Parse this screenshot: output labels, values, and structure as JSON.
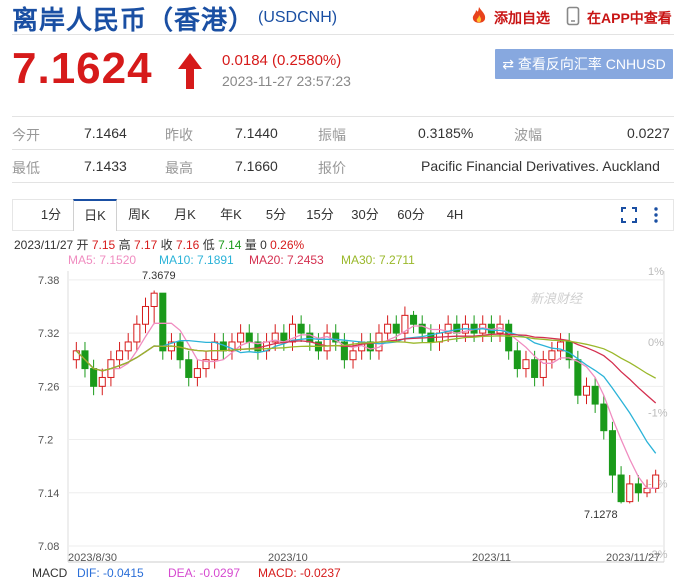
{
  "header": {
    "title": "离岸人民币（香港）",
    "code": "(USDCNH)",
    "add_watch": "添加自选",
    "app_view": "在APP中查看"
  },
  "quote": {
    "price": "7.1624",
    "change": "0.0184 (0.2580%)",
    "time": "2023-11-27 23:57:23",
    "reverse_button": "查看反向汇率 CNHUSD"
  },
  "stats": {
    "open_label": "今开",
    "open": "7.1464",
    "prev_label": "昨收",
    "prev": "7.1440",
    "amp_label": "振幅",
    "amp": "0.3185%",
    "wave_label": "波幅",
    "wave": "0.0227",
    "low_label": "最低",
    "low": "7.1433",
    "high_label": "最高",
    "high": "7.1660",
    "quote_label": "报价",
    "quote_src": "Pacific Financial Derivatives. Auckland"
  },
  "tabs": [
    "1分",
    "日K",
    "周K",
    "月K",
    "年K",
    "5分",
    "15分",
    "30分",
    "60分",
    "4H"
  ],
  "active_tab": "日K",
  "kline_info": {
    "date": "2023/11/27",
    "open_l": "开",
    "open": "7.15",
    "high_l": "高",
    "high": "7.17",
    "close_l": "收",
    "close": "7.16",
    "low_l": "低",
    "low": "7.14",
    "vol_l": "量",
    "vol": "0",
    "pct": "0.26%"
  },
  "ma": {
    "ma5": "MA5: 7.1520",
    "ma10": "MA10: 7.1891",
    "ma20": "MA20: 7.2453",
    "ma30": "MA30: 7.2711"
  },
  "macd": {
    "label": "MACD",
    "dif": "DIF: -0.0415",
    "dea": "DEA: -0.0297",
    "macd": "MACD: -0.0237"
  },
  "colors": {
    "up": "#d61a1a",
    "down": "#1a9a1a",
    "ma5": "#f08cc0",
    "ma10": "#2bb3d8",
    "ma20": "#d42f4f",
    "ma30": "#9ab82a"
  },
  "chart_data": {
    "type": "candlestick",
    "y_ticks": [
      "7.38",
      "7.32",
      "7.26",
      "7.2",
      "7.14",
      "7.08"
    ],
    "pct_ticks": [
      "1%",
      "0%",
      "-1%",
      "-2%",
      "-3%"
    ],
    "x_ticks": [
      "2023/8/30",
      "2023/10",
      "2023/11",
      "2023/11/27"
    ],
    "max_label": "7.3679",
    "min_label": "7.1278",
    "watermark": "新浪财经",
    "ylim": [
      7.08,
      7.39
    ],
    "candles": [
      [
        7.29,
        7.3,
        7.28,
        7.31
      ],
      [
        7.3,
        7.28,
        7.27,
        7.31
      ],
      [
        7.28,
        7.26,
        7.25,
        7.29
      ],
      [
        7.26,
        7.27,
        7.25,
        7.28
      ],
      [
        7.27,
        7.29,
        7.26,
        7.3
      ],
      [
        7.29,
        7.3,
        7.28,
        7.31
      ],
      [
        7.3,
        7.31,
        7.29,
        7.32
      ],
      [
        7.31,
        7.33,
        7.3,
        7.34
      ],
      [
        7.33,
        7.35,
        7.32,
        7.36
      ],
      [
        7.35,
        7.365,
        7.33,
        7.368
      ],
      [
        7.365,
        7.3,
        7.29,
        7.365
      ],
      [
        7.3,
        7.31,
        7.29,
        7.32
      ],
      [
        7.31,
        7.29,
        7.28,
        7.32
      ],
      [
        7.29,
        7.27,
        7.26,
        7.3
      ],
      [
        7.27,
        7.28,
        7.26,
        7.29
      ],
      [
        7.28,
        7.29,
        7.27,
        7.3
      ],
      [
        7.29,
        7.31,
        7.28,
        7.32
      ],
      [
        7.31,
        7.3,
        7.29,
        7.32
      ],
      [
        7.3,
        7.31,
        7.29,
        7.32
      ],
      [
        7.31,
        7.32,
        7.3,
        7.33
      ],
      [
        7.32,
        7.31,
        7.3,
        7.33
      ],
      [
        7.31,
        7.3,
        7.29,
        7.32
      ],
      [
        7.3,
        7.31,
        7.29,
        7.32
      ],
      [
        7.31,
        7.32,
        7.3,
        7.33
      ],
      [
        7.32,
        7.31,
        7.3,
        7.33
      ],
      [
        7.31,
        7.33,
        7.3,
        7.34
      ],
      [
        7.33,
        7.32,
        7.31,
        7.34
      ],
      [
        7.32,
        7.31,
        7.3,
        7.33
      ],
      [
        7.31,
        7.3,
        7.29,
        7.32
      ],
      [
        7.3,
        7.32,
        7.29,
        7.33
      ],
      [
        7.32,
        7.31,
        7.3,
        7.33
      ],
      [
        7.31,
        7.29,
        7.28,
        7.32
      ],
      [
        7.29,
        7.3,
        7.28,
        7.31
      ],
      [
        7.3,
        7.31,
        7.29,
        7.32
      ],
      [
        7.31,
        7.3,
        7.29,
        7.32
      ],
      [
        7.3,
        7.32,
        7.29,
        7.33
      ],
      [
        7.32,
        7.33,
        7.31,
        7.34
      ],
      [
        7.33,
        7.32,
        7.31,
        7.34
      ],
      [
        7.32,
        7.34,
        7.31,
        7.35
      ],
      [
        7.34,
        7.33,
        7.32,
        7.345
      ],
      [
        7.33,
        7.32,
        7.31,
        7.34
      ],
      [
        7.32,
        7.31,
        7.3,
        7.33
      ],
      [
        7.31,
        7.32,
        7.3,
        7.33
      ],
      [
        7.32,
        7.33,
        7.31,
        7.34
      ],
      [
        7.33,
        7.32,
        7.31,
        7.34
      ],
      [
        7.32,
        7.33,
        7.31,
        7.34
      ],
      [
        7.33,
        7.32,
        7.31,
        7.34
      ],
      [
        7.32,
        7.33,
        7.31,
        7.34
      ],
      [
        7.33,
        7.32,
        7.31,
        7.34
      ],
      [
        7.32,
        7.33,
        7.31,
        7.34
      ],
      [
        7.33,
        7.3,
        7.29,
        7.335
      ],
      [
        7.3,
        7.28,
        7.27,
        7.31
      ],
      [
        7.28,
        7.29,
        7.27,
        7.3
      ],
      [
        7.29,
        7.27,
        7.26,
        7.3
      ],
      [
        7.27,
        7.29,
        7.26,
        7.3
      ],
      [
        7.29,
        7.3,
        7.28,
        7.31
      ],
      [
        7.3,
        7.31,
        7.29,
        7.32
      ],
      [
        7.31,
        7.29,
        7.28,
        7.32
      ],
      [
        7.29,
        7.25,
        7.24,
        7.3
      ],
      [
        7.25,
        7.26,
        7.24,
        7.27
      ],
      [
        7.26,
        7.24,
        7.23,
        7.27
      ],
      [
        7.24,
        7.21,
        7.2,
        7.25
      ],
      [
        7.21,
        7.16,
        7.14,
        7.22
      ],
      [
        7.16,
        7.13,
        7.128,
        7.17
      ],
      [
        7.13,
        7.15,
        7.128,
        7.16
      ],
      [
        7.15,
        7.14,
        7.13,
        7.16
      ],
      [
        7.14,
        7.145,
        7.135,
        7.155
      ],
      [
        7.145,
        7.16,
        7.14,
        7.166
      ]
    ]
  }
}
